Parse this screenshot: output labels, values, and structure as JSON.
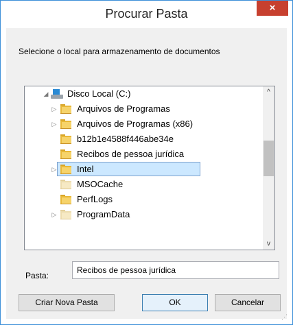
{
  "window": {
    "title": "Procurar Pasta",
    "close_glyph": "×"
  },
  "prompt": "Selecione o local para armazenamento de documentos",
  "tree": {
    "root": {
      "label": "Disco Local (C:)",
      "icon": "drive-icon",
      "expander": "◢"
    },
    "items": [
      {
        "label": "Arquivos de Programas",
        "expander": "▷"
      },
      {
        "label": "Arquivos de Programas (x86)",
        "expander": "▷"
      },
      {
        "label": "b12b1e4588f446abe34e",
        "expander": ""
      },
      {
        "label": "Recibos de pessoa jurídica",
        "expander": "",
        "selected": true
      },
      {
        "label": "Intel",
        "expander": "▷"
      },
      {
        "label": "MSOCache",
        "expander": ""
      },
      {
        "label": "PerfLogs",
        "expander": ""
      },
      {
        "label": "ProgramData",
        "expander": "▷"
      }
    ],
    "scroll_up": "^",
    "scroll_down": "v"
  },
  "folder_field": {
    "label": "Pasta:",
    "value": "Recibos de pessoa jurídica"
  },
  "buttons": {
    "new_folder": "Criar Nova Pasta",
    "ok": "OK",
    "cancel": "Cancelar"
  },
  "colors": {
    "accent": "#3c8fd8",
    "close": "#c7402f",
    "selection": "#cce8ff",
    "folder": "#e8b838"
  }
}
